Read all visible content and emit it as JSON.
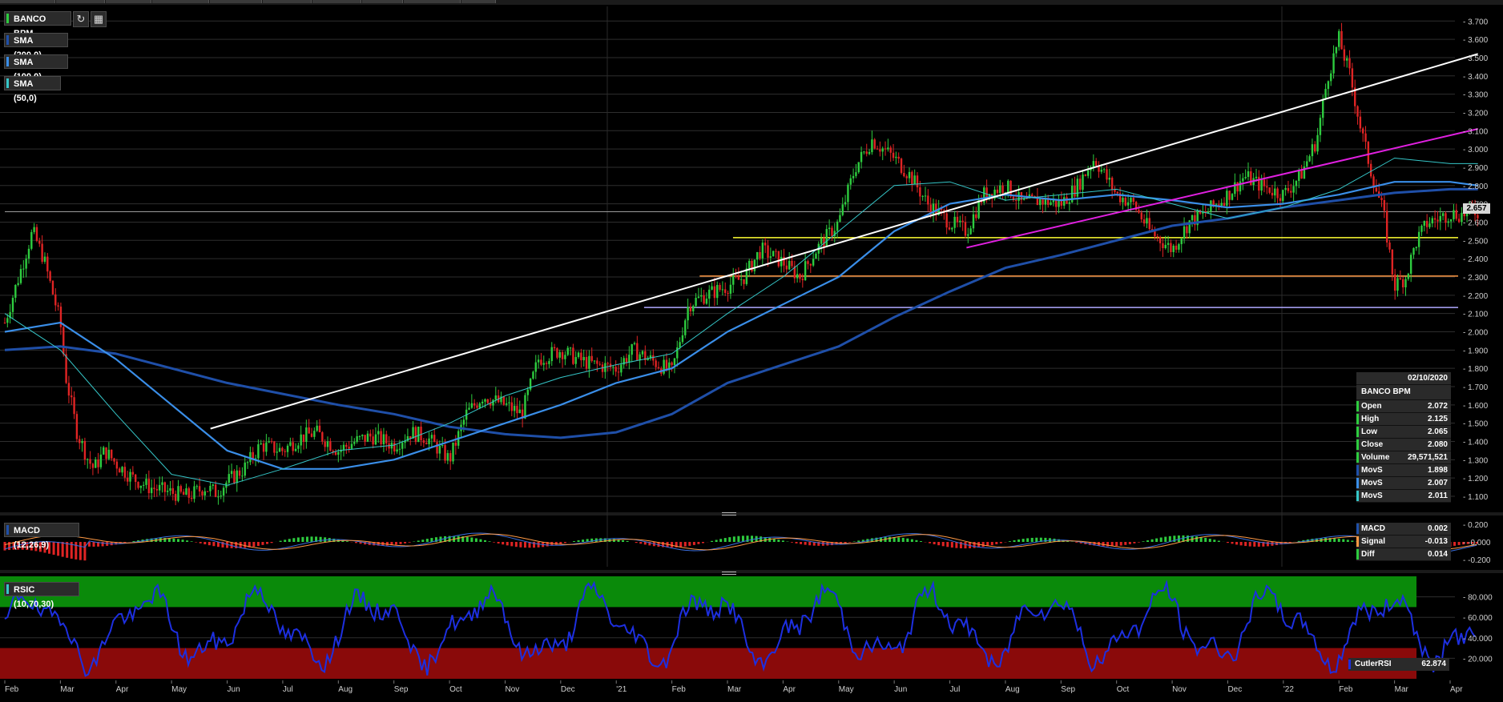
{
  "toolbar": {
    "refresh_icon": "refresh-icon",
    "calendar_icon": "calendar-icon"
  },
  "legend": {
    "instrument": "BANCO BPM",
    "sma200": "SMA (200,0)",
    "sma100": "SMA (100,0)",
    "sma50": "SMA (50,0)",
    "macd": "MACD (12,26,9)",
    "rsi": "RSIC (10,70,30)"
  },
  "colors": {
    "background": "#000000",
    "up": "#2ecc3f",
    "down": "#e02424",
    "sma200": "#1f4fa8",
    "sma100": "#3a8ee8",
    "sma50": "#35c6c8",
    "trend_white": "#ffffff",
    "trend_magenta": "#e020e0",
    "support_yellow": "#ffff33",
    "support_orange": "#ff9944",
    "support_lavender": "#b0a8ff",
    "rsi_line": "#1d2fe0",
    "rsi_overbought": "#0a8a0a",
    "rsi_oversold": "#8a0a0a"
  },
  "price_tag": "2.657",
  "info_panel": {
    "date": "02/10/2020",
    "name": "BANCO BPM",
    "rows": [
      {
        "label": "Open",
        "value": "2.072"
      },
      {
        "label": "High",
        "value": "2.125"
      },
      {
        "label": "Low",
        "value": "2.065"
      },
      {
        "label": "Close",
        "value": "2.080"
      },
      {
        "label": "Volume",
        "value": "29,571,521"
      },
      {
        "label": "MovS",
        "value": "1.898"
      },
      {
        "label": "MovS",
        "value": "2.007"
      },
      {
        "label": "MovS",
        "value": "2.011"
      }
    ]
  },
  "macd_panel": {
    "rows": [
      {
        "label": "MACD",
        "value": "0.002"
      },
      {
        "label": "Signal",
        "value": "-0.013"
      },
      {
        "label": "Diff",
        "value": "0.014"
      }
    ]
  },
  "rsi_panel": {
    "label": "CutlerRSI",
    "value": "62.874"
  },
  "chart_data": [
    {
      "type": "line",
      "title": "BANCO BPM",
      "x_axis_labels": [
        "Feb",
        "Mar",
        "Apr",
        "May",
        "Jun",
        "Jul",
        "Aug",
        "Sep",
        "Oct",
        "Nov",
        "Dec",
        "'21",
        "Feb",
        "Mar",
        "Apr",
        "May",
        "Jun",
        "Jul",
        "Aug",
        "Sep",
        "Oct",
        "Nov",
        "Dec",
        "'22",
        "Feb",
        "Mar",
        "Apr"
      ],
      "y_ticks": [
        "1.100",
        "1.200",
        "1.300",
        "1.400",
        "1.500",
        "1.600",
        "1.700",
        "1.800",
        "1.900",
        "2.000",
        "2.100",
        "2.200",
        "2.300",
        "2.400",
        "2.500",
        "2.600",
        "2.700",
        "2.800",
        "2.900",
        "3.000",
        "3.100",
        "3.200",
        "3.300",
        "3.400",
        "3.500",
        "3.600",
        "3.700"
      ],
      "ylim": [
        1.03,
        3.78
      ],
      "x_domain": [
        0,
        26
      ],
      "series": [
        {
          "name": "BANCO BPM",
          "x": [
            0,
            0.3,
            0.5,
            0.7,
            1.0,
            1.1,
            1.3,
            1.5,
            1.6,
            1.8,
            2.0,
            2.3,
            2.6,
            3.0,
            3.3,
            3.6,
            3.8,
            4.0,
            4.3,
            4.6,
            5.0,
            5.3,
            5.6,
            6.0,
            6.3,
            6.6,
            7.0,
            7.3,
            7.6,
            8.0,
            8.3,
            8.6,
            9.0,
            9.3,
            9.6,
            10.0,
            10.3,
            10.6,
            11.0,
            11.3,
            11.6,
            12.0,
            12.3,
            12.6,
            13.0,
            13.3,
            13.6,
            14.0,
            14.3,
            14.6,
            15.0,
            15.3,
            15.6,
            16.0,
            16.3,
            16.6,
            17.0,
            17.3,
            17.6,
            18.0,
            18.3,
            18.6,
            19.0,
            19.3,
            19.6,
            20.0,
            20.3,
            20.6,
            21.0,
            21.3,
            21.6,
            22.0,
            22.3,
            22.6,
            23.0,
            23.3,
            23.6,
            23.8,
            24.0,
            24.2,
            24.4,
            24.6,
            24.8,
            25.0,
            25.2,
            25.4,
            25.6,
            25.8,
            26.0,
            26.2,
            26.4,
            26.5
          ],
          "y": [
            2.05,
            2.35,
            2.55,
            2.4,
            2.05,
            1.75,
            1.45,
            1.3,
            1.25,
            1.35,
            1.28,
            1.2,
            1.15,
            1.12,
            1.1,
            1.15,
            1.12,
            1.18,
            1.25,
            1.38,
            1.35,
            1.42,
            1.45,
            1.35,
            1.4,
            1.43,
            1.38,
            1.45,
            1.42,
            1.3,
            1.55,
            1.65,
            1.6,
            1.55,
            1.85,
            1.9,
            1.85,
            1.82,
            1.8,
            1.9,
            1.85,
            1.78,
            2.15,
            2.2,
            2.25,
            2.3,
            2.45,
            2.38,
            2.3,
            2.45,
            2.6,
            2.9,
            3.05,
            2.95,
            2.85,
            2.7,
            2.6,
            2.55,
            2.75,
            2.8,
            2.7,
            2.72,
            2.7,
            2.8,
            2.95,
            2.75,
            2.7,
            2.55,
            2.45,
            2.6,
            2.65,
            2.75,
            2.85,
            2.8,
            2.75,
            2.85,
            3.05,
            3.4,
            3.6,
            3.4,
            3.1,
            2.85,
            2.65,
            2.25,
            2.3,
            2.5,
            2.6,
            2.62,
            2.65,
            2.64,
            2.66,
            2.657
          ]
        },
        {
          "name": "SMA (200,0)",
          "x": [
            0,
            1,
            2,
            3,
            4,
            5,
            6,
            7,
            8,
            9,
            10,
            11,
            12,
            13,
            14,
            15,
            16,
            17,
            18,
            19,
            20,
            21,
            22,
            23,
            24,
            25,
            26,
            26.5
          ],
          "y": [
            1.9,
            1.92,
            1.88,
            1.8,
            1.72,
            1.66,
            1.6,
            1.55,
            1.48,
            1.44,
            1.42,
            1.45,
            1.55,
            1.72,
            1.82,
            1.92,
            2.08,
            2.22,
            2.35,
            2.42,
            2.5,
            2.58,
            2.62,
            2.68,
            2.72,
            2.76,
            2.78,
            2.78
          ]
        },
        {
          "name": "SMA (100,0)",
          "x": [
            0,
            1,
            2,
            3,
            4,
            5,
            6,
            7,
            8,
            9,
            10,
            11,
            12,
            13,
            14,
            15,
            16,
            17,
            18,
            19,
            20,
            21,
            22,
            23,
            24,
            25,
            26,
            26.5
          ],
          "y": [
            2.0,
            2.05,
            1.85,
            1.6,
            1.35,
            1.25,
            1.25,
            1.3,
            1.4,
            1.5,
            1.6,
            1.72,
            1.8,
            2.0,
            2.15,
            2.3,
            2.55,
            2.7,
            2.75,
            2.72,
            2.75,
            2.72,
            2.68,
            2.7,
            2.75,
            2.82,
            2.82,
            2.8
          ]
        },
        {
          "name": "SMA (50,0)",
          "x": [
            0,
            1,
            2,
            3,
            4,
            5,
            6,
            7,
            8,
            9,
            10,
            11,
            12,
            13,
            14,
            15,
            16,
            17,
            18,
            19,
            20,
            21,
            22,
            23,
            24,
            25,
            26,
            26.5
          ],
          "y": [
            2.1,
            1.9,
            1.55,
            1.22,
            1.16,
            1.25,
            1.35,
            1.38,
            1.5,
            1.65,
            1.75,
            1.82,
            1.88,
            2.1,
            2.3,
            2.55,
            2.8,
            2.82,
            2.72,
            2.75,
            2.78,
            2.7,
            2.62,
            2.68,
            2.78,
            2.95,
            2.92,
            2.92
          ]
        }
      ],
      "horizontal_levels": [
        2.515,
        2.305,
        2.133,
        2.657
      ],
      "trendlines": [
        {
          "x": [
            3.7,
            26.5
          ],
          "y": [
            1.47,
            3.52
          ]
        },
        {
          "x": [
            17.3,
            26.5
          ],
          "y": [
            2.46,
            3.11
          ]
        }
      ]
    },
    {
      "type": "line",
      "title": "MACD (12,26,9)",
      "y_ticks": [
        "-0.200",
        "-0.000",
        "0.200"
      ],
      "ylim": [
        -0.28,
        0.28
      ]
    },
    {
      "type": "line",
      "title": "RSIC (10,70,30)",
      "y_ticks": [
        "20.000",
        "40.000",
        "60.000",
        "80.000"
      ],
      "ylim": [
        0,
        100
      ],
      "bands": {
        "overbought": [
          70,
          100
        ],
        "oversold": [
          0,
          30
        ]
      }
    }
  ]
}
